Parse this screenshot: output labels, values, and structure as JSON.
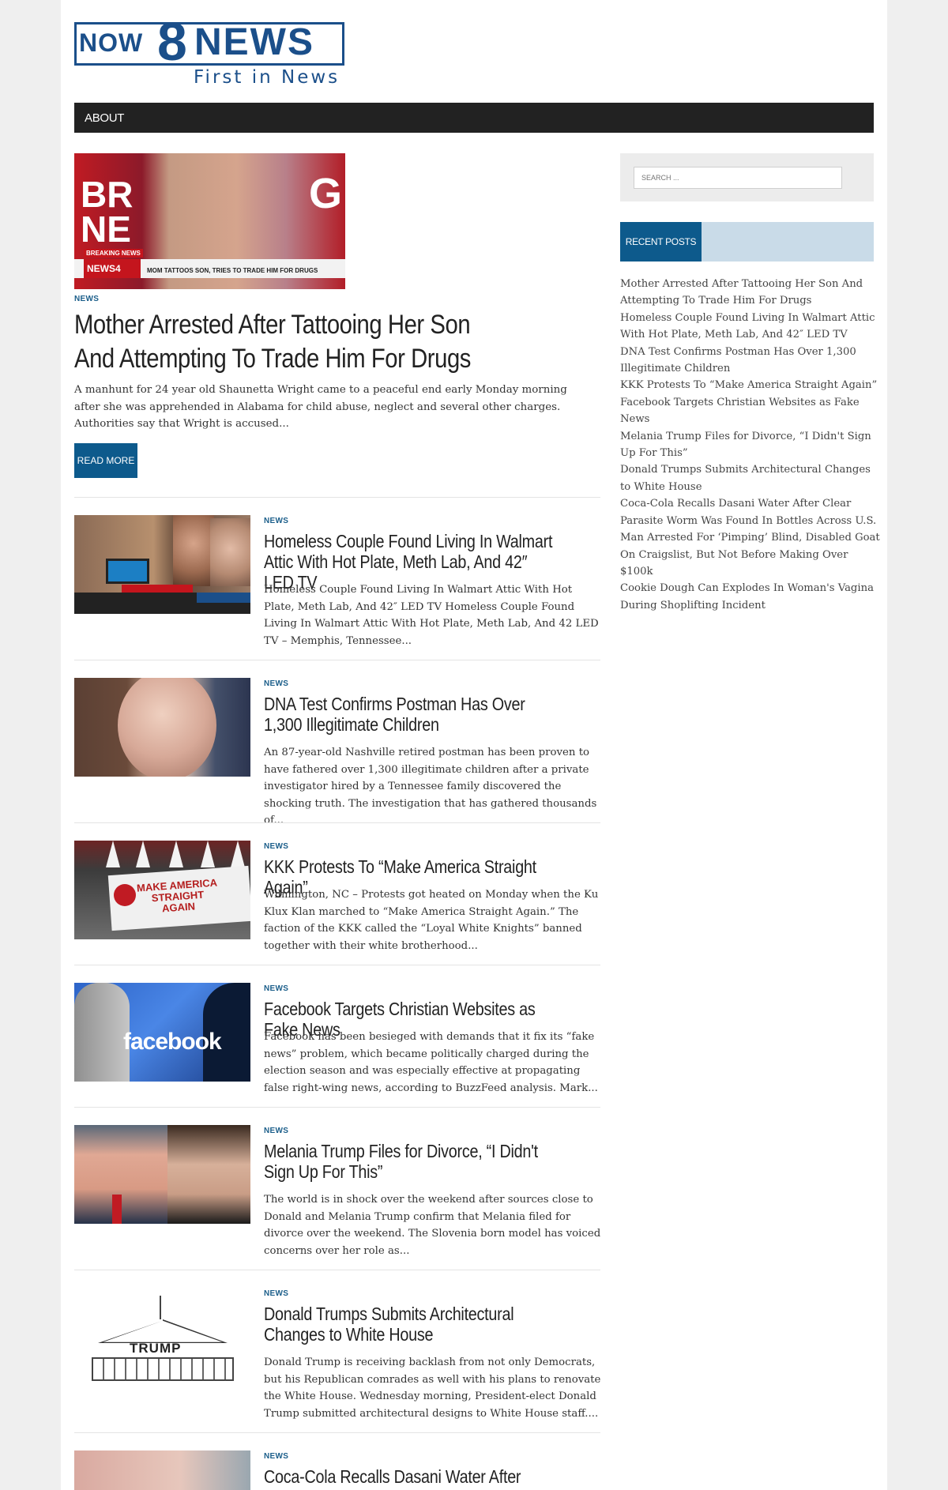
{
  "logo": {
    "now": "NOW",
    "eight": "8",
    "news": "NEWS",
    "tagline": "First in News"
  },
  "nav": {
    "items": [
      {
        "label": "ABOUT"
      }
    ]
  },
  "featured": {
    "image": {
      "overlay_left": "BR\nNE",
      "overlay_right": "G",
      "breaking": "BREAKING NEWS",
      "station": "NEWS4",
      "caption": "MOM TATTOOS SON, TRIES TO TRADE HIM FOR DRUGS"
    },
    "category": "NEWS",
    "title": "Mother Arrested After Tattooing Her Son And Attempting To Trade Him For Drugs",
    "excerpt": "A manhunt for 24 year old Shaunetta Wright came to a peaceful end early Monday morning after she was apprehended in Alabama for child abuse, neglect and several other charges. Authorities say that Wright is accused...",
    "read_more": "READ MORE"
  },
  "articles": [
    {
      "category": "NEWS",
      "title": "Homeless Couple Found Living In Walmart Attic With Hot Plate, Meth Lab, And 42″ LED TV",
      "excerpt": "Homeless Couple Found Living In Walmart Attic With Hot Plate, Meth Lab, And 42″ LED TV Homeless Couple Found Living In Walmart Attic With Hot Plate, Meth Lab, And 42 LED TV – Memphis, Tennessee..."
    },
    {
      "category": "NEWS",
      "title": "DNA Test Confirms Postman Has Over 1,300 Illegitimate Children",
      "excerpt": "An 87-year-old Nashville retired postman has been proven to have fathered over 1,300 illegitimate children after a private investigator hired by a Tennessee family discovered the shocking truth. The investigation that has gathered thousands of..."
    },
    {
      "category": "NEWS",
      "title": "KKK Protests To “Make America Straight Again”",
      "excerpt": "Wilmington, NC – Protests got heated on Monday when the Ku Klux Klan marched to “Make America Straight Again.” The faction of the KKK called the “Loyal White Knights” banned together with their white brotherhood...",
      "image_text": "MAKE AMERICA\nSTRAIGHT\nAGAIN"
    },
    {
      "category": "NEWS",
      "title": "Facebook Targets Christian Websites as Fake News",
      "excerpt": "Facebook has been besieged with demands that it fix its “fake news” problem, which became politically charged during the election season and was especially effective at propagating false right-wing news, according to BuzzFeed analysis. Mark...",
      "image_text": "facebook"
    },
    {
      "category": "NEWS",
      "title": "Melania Trump Files for Divorce, “I Didn't Sign Up For This”",
      "excerpt": "The world is in shock over the weekend after sources close to Donald and Melania Trump confirm that Melania filed for divorce over the weekend. The Slovenia born model has voiced concerns over her role as..."
    },
    {
      "category": "NEWS",
      "title": "Donald Trumps Submits Architectural Changes to White House",
      "excerpt": "Donald Trump is receiving backlash from not only Democrats, but his Republican comrades as well with his plans to renovate the White House. Wednesday morning, President-elect Donald Trump submitted architectural designs to White House staff....",
      "image_text": "TRUMP"
    },
    {
      "category": "NEWS",
      "title": "Coca-Cola Recalls Dasani Water After Clear Parasite Worm Was Found In Bottles Across U.S.",
      "excerpt": ""
    }
  ],
  "sidebar": {
    "search_placeholder": "SEARCH ...",
    "recent_posts_label": "RECENT POSTS",
    "recent_posts": [
      "Mother Arrested After Tattooing Her Son And Attempting To Trade Him For Drugs",
      "Homeless Couple Found Living In Walmart Attic With Hot Plate, Meth Lab, And 42″ LED TV",
      "DNA Test Confirms Postman Has Over 1,300 Illegitimate Children",
      "KKK Protests To “Make America Straight Again”",
      "Facebook Targets Christian Websites as Fake News",
      "Melania Trump Files for Divorce, “I Didn't Sign Up For This”",
      "Donald Trumps Submits Architectural Changes to White House",
      "Coca-Cola Recalls Dasani Water After Clear Parasite Worm Was Found In Bottles Across U.S.",
      "Man Arrested For ‘Pimping’ Blind, Disabled Goat On Craigslist, But Not Before Making Over $100k",
      "Cookie Dough Can Explodes In Woman's Vagina During Shoplifting Incident"
    ]
  },
  "colors": {
    "brand_blue": "#1b4f8a",
    "accent_blue": "#0d5a8c",
    "nav_bg": "#222222",
    "sidebar_header_bg": "#c9dbe8",
    "page_bg": "#efefef"
  }
}
